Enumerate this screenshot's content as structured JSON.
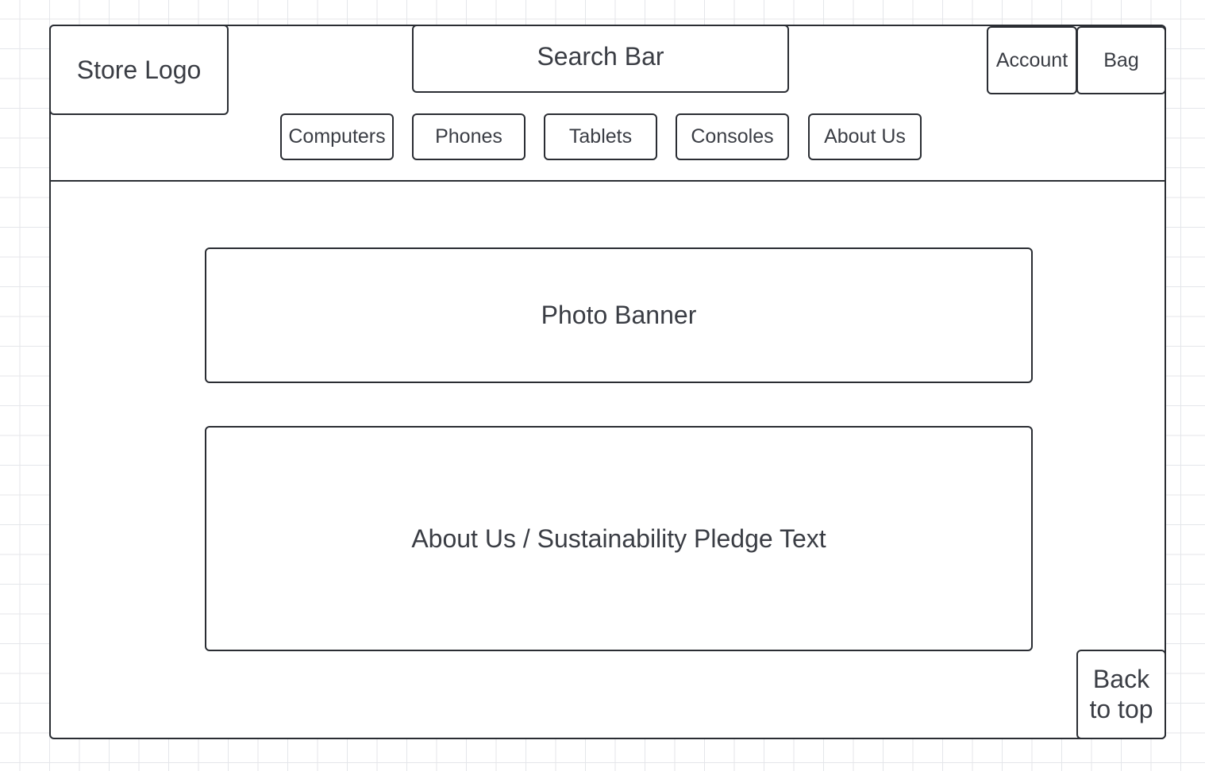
{
  "header": {
    "logo_label": "Store Logo",
    "search_label": "Search Bar",
    "account_label": "Account",
    "bag_label": "Bag"
  },
  "nav": {
    "items": [
      {
        "label": "Computers"
      },
      {
        "label": "Phones"
      },
      {
        "label": "Tablets"
      },
      {
        "label": "Consoles"
      },
      {
        "label": "About Us"
      }
    ]
  },
  "main": {
    "banner_label": "Photo Banner",
    "about_label": "About Us / Sustainability Pledge Text"
  },
  "footer": {
    "back_to_top_lines": [
      "Back",
      "to top"
    ]
  }
}
